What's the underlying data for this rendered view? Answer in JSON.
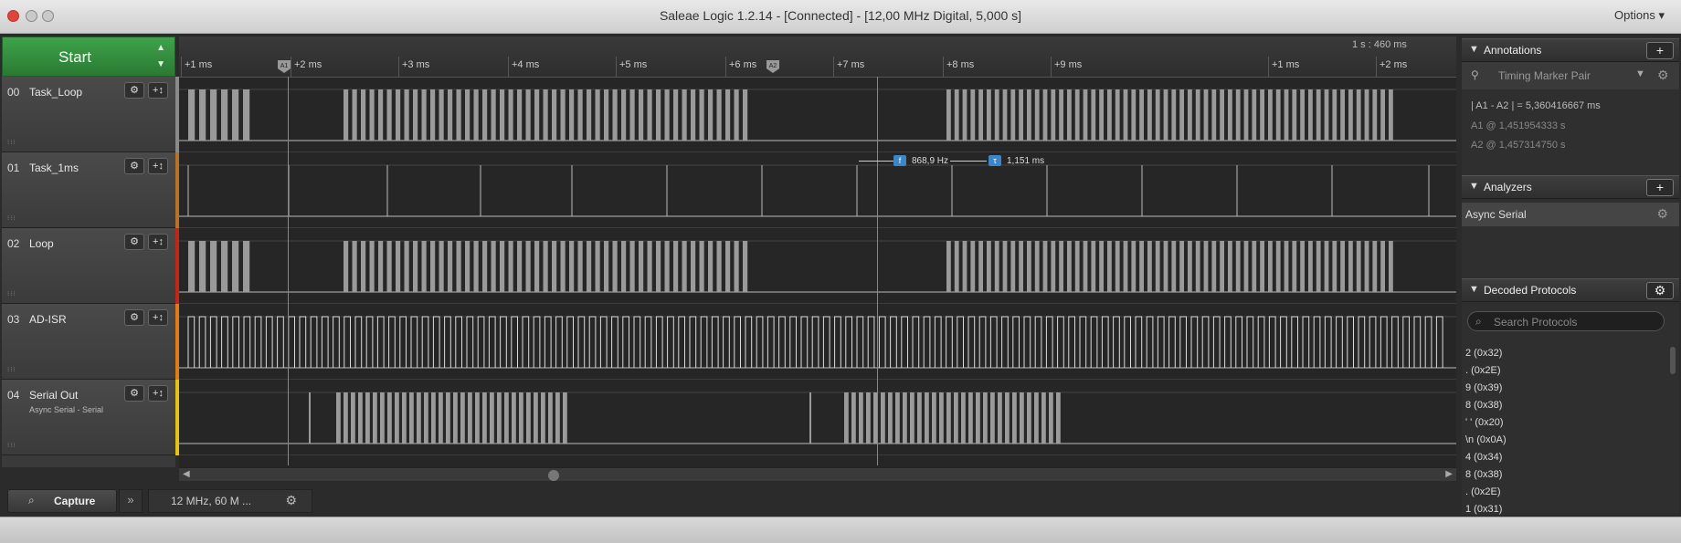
{
  "window": {
    "title": "Saleae Logic 1.2.14 - [Connected] - [12,00 MHz Digital, 5,000 s]",
    "options_label": "Options ▾"
  },
  "start": {
    "label": "Start"
  },
  "ruler": {
    "top_label": "1 s : 460 ms",
    "ticks": [
      "+1 ms",
      "+2 ms",
      "+3 ms",
      "+4 ms",
      "+5 ms",
      "+6 ms",
      "+7 ms",
      "+8 ms",
      "+9 ms",
      "+1 ms",
      "+2 ms"
    ],
    "marker_a1": "A1",
    "marker_a2": "A2"
  },
  "channels": [
    {
      "num": "00",
      "name": "Task_Loop",
      "sub": "",
      "color": "#8a8a8a"
    },
    {
      "num": "01",
      "name": "Task_1ms",
      "sub": "",
      "color": "#b5722a"
    },
    {
      "num": "02",
      "name": "Loop",
      "sub": "",
      "color": "#c0271b"
    },
    {
      "num": "03",
      "name": "AD-ISR",
      "sub": "",
      "color": "#e07b1a"
    },
    {
      "num": "04",
      "name": "Serial Out",
      "sub": "Async Serial - Serial",
      "color": "#e3c21a"
    }
  ],
  "measurement": {
    "freq": "868,9 Hz",
    "width": "1,151 ms",
    "freq_badge": "f",
    "width_badge": "τ"
  },
  "tabs": {
    "capture": "Capture",
    "settings": "12 MHz, 60 M ..."
  },
  "annotations": {
    "title": "Annotations",
    "marker_pair": "Timing Marker Pair",
    "diff_line": "| A1 - A2 | = 5,360416667 ms",
    "a1_line": "A1 @ 1,451954333 s",
    "a2_line": "A2 @ 1,457314750 s"
  },
  "analyzers": {
    "title": "Analyzers",
    "items": [
      "Async Serial"
    ]
  },
  "decoded": {
    "title": "Decoded Protocols",
    "search_placeholder": "Search Protocols",
    "items": [
      "2 (0x32)",
      ". (0x2E)",
      "9 (0x39)",
      "8 (0x38)",
      "' ' (0x20)",
      "\\n (0x0A)",
      "4 (0x34)",
      "8 (0x38)",
      ". (0x2E)",
      "1 (0x31)"
    ]
  }
}
